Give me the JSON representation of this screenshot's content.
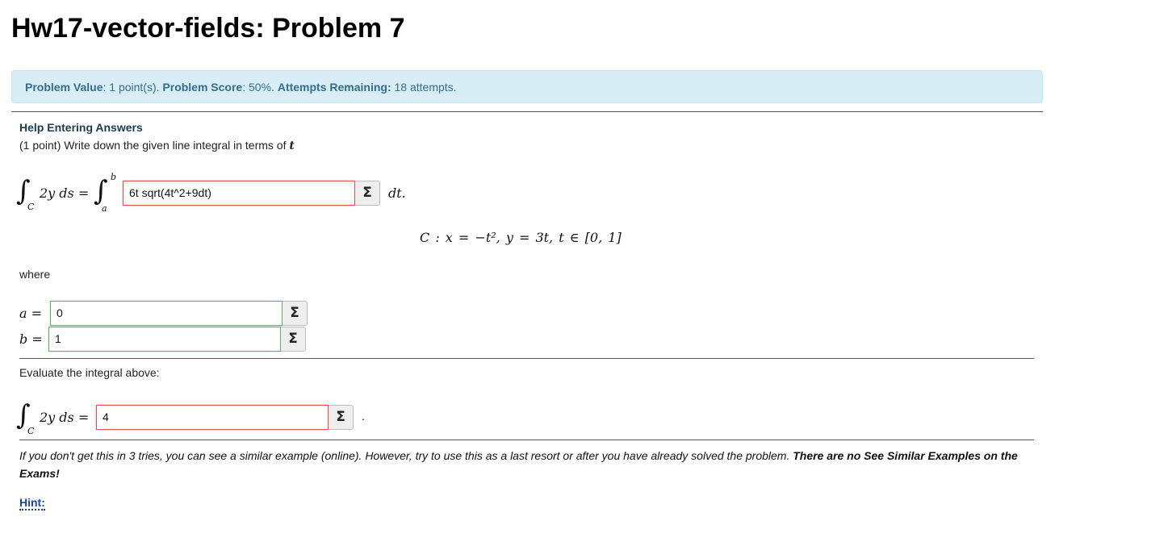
{
  "page": {
    "title": "Hw17-vector-fields: Problem 7"
  },
  "info": {
    "value_label": "Problem Value",
    "value_text": ": 1 point(s). ",
    "score_label": "Problem Score",
    "score_text": ": 50%. ",
    "attempts_label": "Attempts Remaining:",
    "attempts_text": " 18 attempts."
  },
  "problem": {
    "help_link": "Help Entering Answers",
    "statement": "(1 point) Write down the given line integral in terms of",
    "statement_var": "t",
    "integrand_lhs": "2y ds =",
    "upper_limit": "b",
    "lower_limit": "a",
    "curve_sub": "C",
    "answer1": "6t sqrt(4t^2+9dt)",
    "dt_label": "dt.",
    "curve_def": "C : x = −t², y = 3t, t ∈ [0, 1]",
    "where_label": "where",
    "a_label": "a =",
    "b_label": "b =",
    "answer_a": "0",
    "answer_b": "1",
    "evaluate_label": "Evaluate the integral above:",
    "integrand2": "2y ds =",
    "answer2": "4",
    "period": ".",
    "sigma": "Σ"
  },
  "footer": {
    "note_italic": "If you don't get this in 3 tries, you can see a similar example (online). However, try to use this as a last resort or after you have already solved the problem. ",
    "note_bold": "There are no See Similar Examples on the Exams!",
    "hint": "Hint:"
  },
  "colors": {
    "info_bg": "#d9edf7",
    "info_text": "#31708f",
    "wrong_border": "#d9534f",
    "right_border": "#5cb85c",
    "hint_link": "#1a3fb5"
  }
}
